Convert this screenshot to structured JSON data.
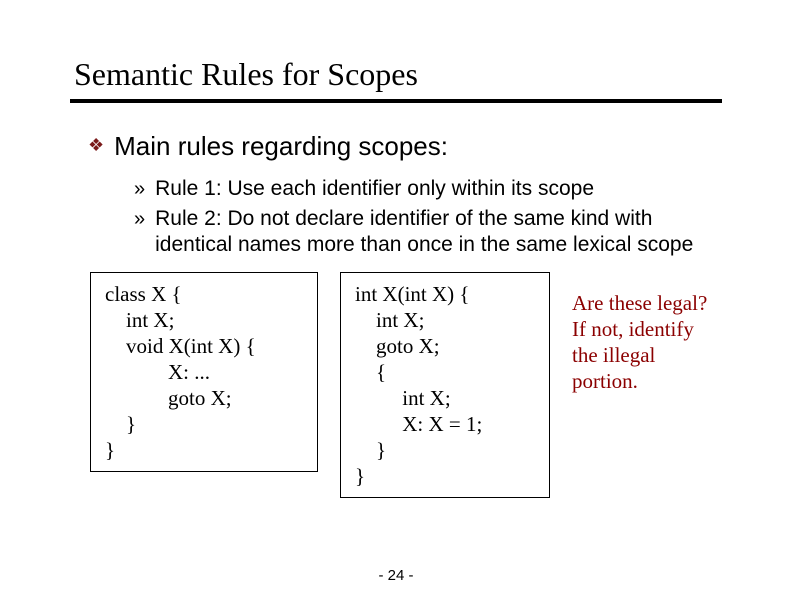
{
  "title": "Semantic Rules for Scopes",
  "main": "Main rules regarding scopes:",
  "rules": {
    "r1": "Rule 1: Use each identifier only within its scope",
    "r2": "Rule 2: Do not declare identifier of the same kind with identical names more than once in the same lexical scope"
  },
  "code1": "class X {\n    int X;\n    void X(int X) {\n            X: ...\n            goto X;\n    }\n}",
  "code2": "int X(int X) {\n    int X;\n    goto X;\n    {\n         int X;\n         X: X = 1;\n    }\n}",
  "annotation": "Are these legal?  If not, identify the illegal portion.",
  "footer": "- 24 -"
}
